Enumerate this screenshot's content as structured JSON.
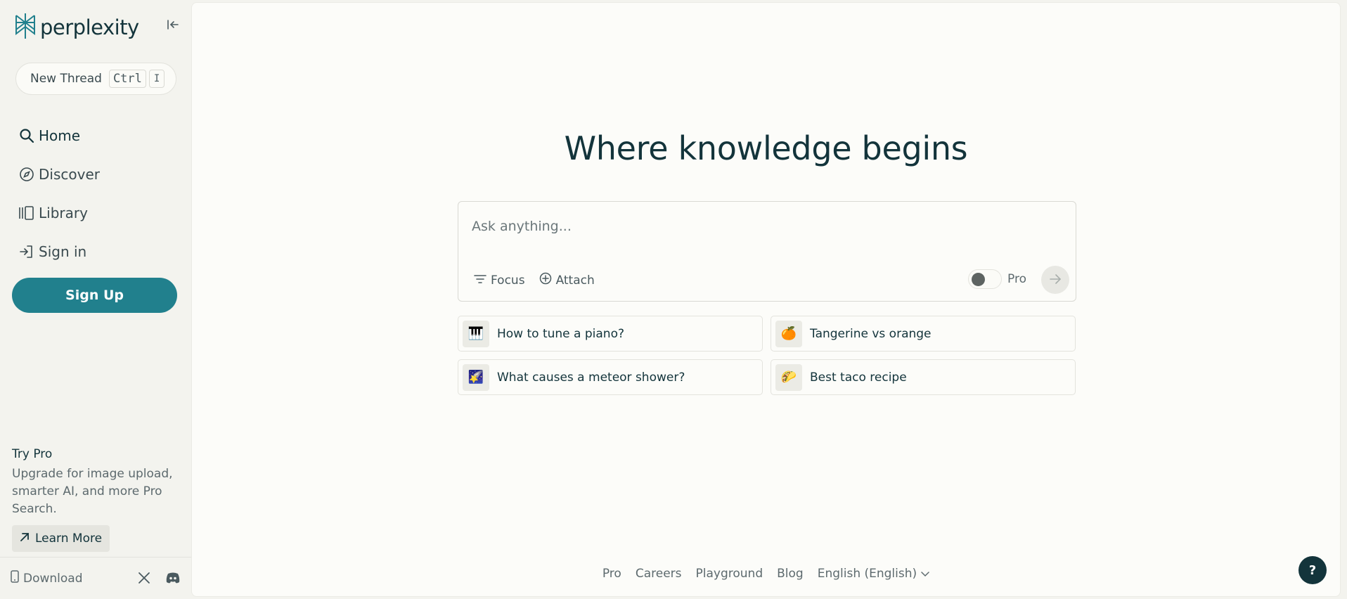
{
  "sidebar": {
    "brand": "perplexity",
    "new_thread": {
      "label": "New Thread",
      "key1": "Ctrl",
      "key2": "I"
    },
    "nav": [
      {
        "label": "Home",
        "icon": "search-icon"
      },
      {
        "label": "Discover",
        "icon": "compass-icon"
      },
      {
        "label": "Library",
        "icon": "library-icon"
      },
      {
        "label": "Sign in",
        "icon": "sign-in-icon"
      }
    ],
    "signup_label": "Sign Up",
    "try_pro": {
      "title": "Try Pro",
      "text": "Upgrade for image upload, smarter AI, and more Pro Search.",
      "button": "Learn More"
    },
    "footer": {
      "download": "Download"
    }
  },
  "main": {
    "headline": "Where knowledge begins",
    "ask": {
      "placeholder": "Ask anything...",
      "focus": "Focus",
      "attach": "Attach",
      "pro": "Pro",
      "pro_enabled": false
    },
    "suggestions": [
      {
        "emoji": "🎹",
        "text": "How to tune a piano?"
      },
      {
        "emoji": "🍊",
        "text": "Tangerine vs orange"
      },
      {
        "emoji": "🌠",
        "text": "What causes a meteor shower?"
      },
      {
        "emoji": "🌮",
        "text": "Best taco recipe"
      }
    ],
    "footer_links": [
      "Pro",
      "Careers",
      "Playground",
      "Blog"
    ],
    "language": "English (English)",
    "help": "?"
  },
  "colors": {
    "accent": "#21808d",
    "text": "#13343b",
    "sidebar_bg": "#f3f3ee",
    "main_bg": "#fcfcf9"
  }
}
